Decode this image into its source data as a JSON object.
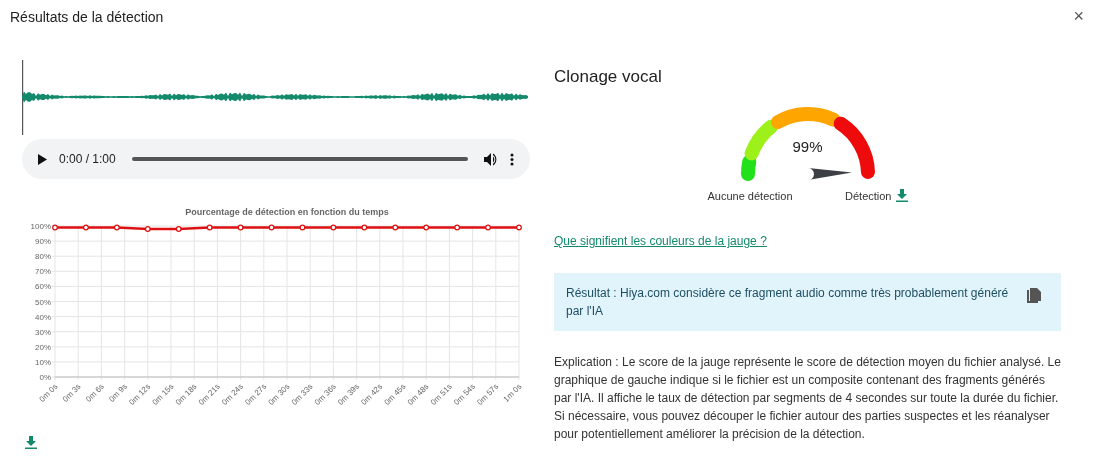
{
  "dialog": {
    "title": "Résultats de la détection",
    "close": "×"
  },
  "audio_player": {
    "time": "0:00 / 1:00"
  },
  "chart": {
    "chart_data": {
      "type": "line",
      "title": "Pourcentage de détection en fonction du temps",
      "categories": [
        "0m 0s",
        null,
        null,
        "0m 3s",
        null,
        null,
        "0m 6s",
        null,
        null,
        "0m 9s",
        null,
        null,
        "0m 12s",
        null,
        null,
        "0m 15s",
        null,
        null,
        "0m 18s",
        null,
        null,
        "0m 21s",
        null,
        null,
        "0m 24s",
        null,
        null,
        "0m 27s",
        null,
        null,
        "0m 30s",
        null,
        null,
        "0m 33s",
        null,
        null,
        "0m 36s",
        null,
        null,
        "0m 39s",
        null,
        null,
        "0m 42s",
        null,
        null,
        "0m 45s",
        null,
        null,
        "0m 48s",
        null,
        null,
        "0m 51s",
        null,
        null,
        "0m 54s",
        null,
        null,
        "0m 57s",
        null,
        null,
        "1m 0s"
      ],
      "grid": true,
      "series": [
        {
          "color": "#dd1111",
          "marker": "circle",
          "values": [
            99,
            null,
            null,
            null,
            99,
            null,
            null,
            null,
            99,
            null,
            null,
            null,
            98,
            null,
            null,
            null,
            98,
            null,
            null,
            null,
            99,
            null,
            null,
            null,
            99,
            null,
            null,
            null,
            99,
            null,
            null,
            null,
            99,
            null,
            null,
            null,
            99,
            null,
            null,
            null,
            99,
            null,
            null,
            null,
            99,
            null,
            null,
            null,
            99,
            null,
            null,
            null,
            99,
            null,
            null,
            null,
            99,
            null,
            null,
            null,
            99
          ]
        }
      ],
      "ylim": [
        0,
        100
      ],
      "yticks": [
        {
          "value": 0,
          "label": "0%"
        },
        {
          "value": 10,
          "label": "10%"
        },
        {
          "value": 20,
          "label": "20%"
        },
        {
          "value": 30,
          "label": "30%"
        },
        {
          "value": 40,
          "label": "40%"
        },
        {
          "value": 50,
          "label": "50%"
        },
        {
          "value": 60,
          "label": "60%"
        },
        {
          "value": 70,
          "label": "70%"
        },
        {
          "value": 80,
          "label": "80%"
        },
        {
          "value": 90,
          "label": "90%"
        },
        {
          "value": 100,
          "label": "100%"
        }
      ]
    }
  },
  "gauge": {
    "title": "Clonage vocal",
    "reading": "99%",
    "min_label": "Aucune détection",
    "max_label": "Détection"
  },
  "gauge_link": "Que signifient les couleurs de la jauge ?",
  "result": "Résultat : Hiya.com considère ce fragment audio comme très probablement généré par l'IA",
  "explanation": "Explication : Le score de la jauge représente le score de détection moyen du fichier analysé. Le graphique de gauche indique si le fichier est un composite contenant des fragments générés par l'IA. Il affiche le taux de détection par segments de 4 secondes sur toute la durée du fichier. Si nécessaire, vous pouvez découper le fichier autour des parties suspectes et les réanalyser pour potentiellement améliorer la précision de la détection."
}
